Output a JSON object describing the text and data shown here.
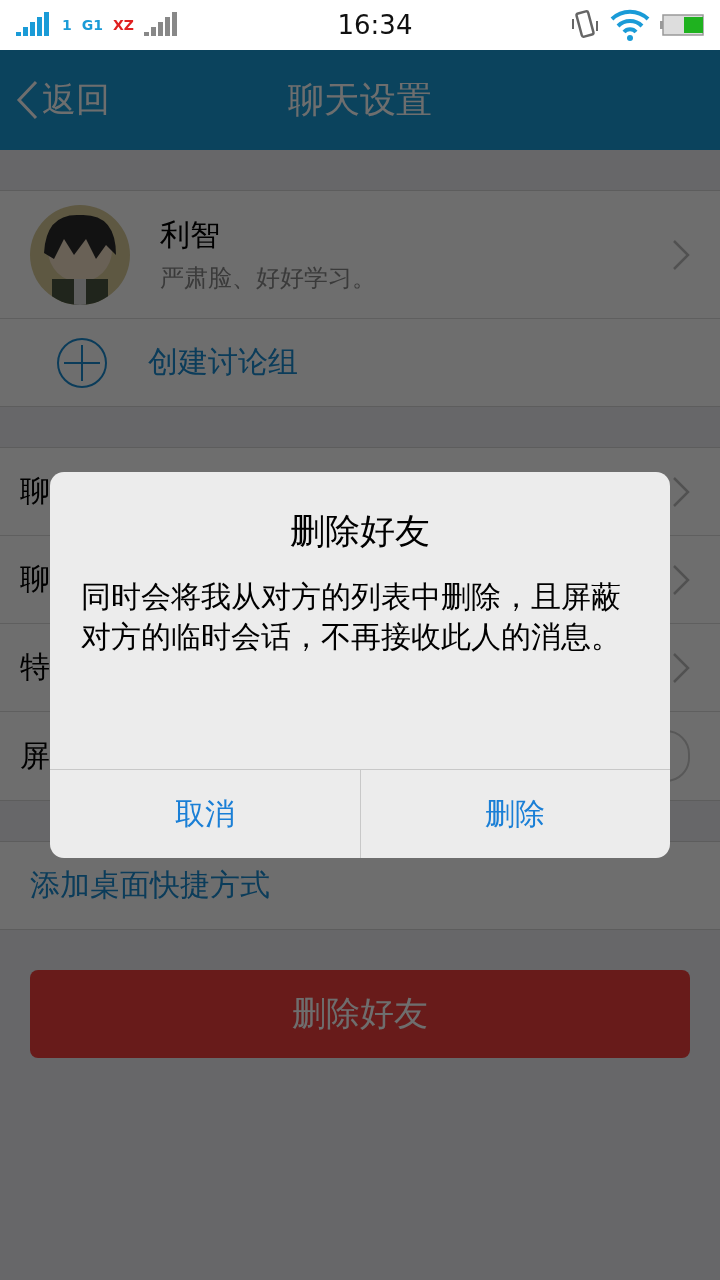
{
  "status_bar": {
    "sim_badge": "1",
    "network": "G1",
    "sim2_badge": "XZ",
    "time": "16:34"
  },
  "nav": {
    "back": "返回",
    "title": "聊天设置"
  },
  "profile": {
    "name": "利智",
    "signature": "严肃脸、好好学习。"
  },
  "create_group": "创建讨论组",
  "settings_rows": [
    {
      "label": "聊",
      "kind": "chevron"
    },
    {
      "label": "聊",
      "kind": "chevron"
    },
    {
      "label": "特",
      "kind": "chevron"
    },
    {
      "label": "屏",
      "kind": "toggle",
      "on": false
    }
  ],
  "shortcut": "添加桌面快捷方式",
  "delete_button": "删除好友",
  "dialog": {
    "title": "删除好友",
    "message": "同时会将我从对方的列表中删除，且屏蔽对方的临时会话，不再接收此人的消息。",
    "buttons": [
      "取消",
      "删除"
    ]
  }
}
